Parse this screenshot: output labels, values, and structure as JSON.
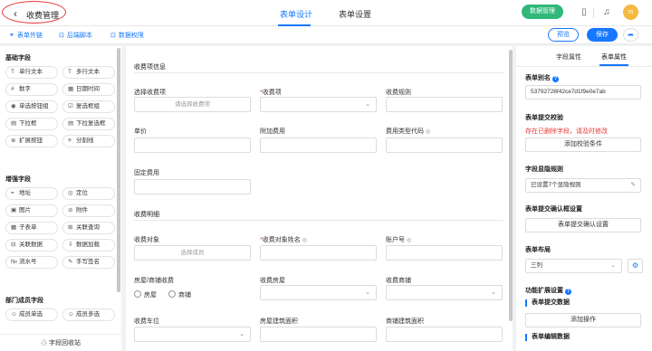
{
  "header": {
    "back_icon": "chevron-left-icon",
    "title": "收费管理",
    "tabs": [
      {
        "label": "表单设计",
        "active": true
      },
      {
        "label": "表单设置",
        "active": false
      }
    ],
    "data_button": "数据管理",
    "avatar_text": "rs",
    "colors": {
      "accent": "#1677ff",
      "data_button": "#2fb87a",
      "avatar": "#f5b93f",
      "highlight": "#e53935"
    }
  },
  "toolbar": {
    "links": [
      "表单外链",
      "后端脚本",
      "数据权限"
    ],
    "preview": "预览",
    "save": "保存"
  },
  "left": {
    "sections": [
      {
        "title": "基础字段",
        "fields": [
          {
            "icon": "text-icon",
            "glyph": "T",
            "label": "单行文本"
          },
          {
            "icon": "textarea-icon",
            "glyph": "T",
            "label": "多行文本"
          },
          {
            "icon": "number-icon",
            "glyph": "#",
            "label": "数字"
          },
          {
            "icon": "calendar-icon",
            "glyph": "▦",
            "label": "日期时间"
          },
          {
            "icon": "radio-icon",
            "glyph": "◉",
            "label": "单选按钮组"
          },
          {
            "icon": "checkbox-icon",
            "glyph": "☑",
            "label": "复选框组"
          },
          {
            "icon": "dropdown-icon",
            "glyph": "▤",
            "label": "下拉框"
          },
          {
            "icon": "multi-dropdown-icon",
            "glyph": "▤",
            "label": "下拉复选框"
          },
          {
            "icon": "expand-button-icon",
            "glyph": "⊕",
            "label": "扩展按钮"
          },
          {
            "icon": "divider-icon",
            "glyph": "≡",
            "label": "分割线"
          }
        ]
      },
      {
        "title": "增强字段",
        "fields": [
          {
            "icon": "address-icon",
            "glyph": "⌖",
            "label": "地址"
          },
          {
            "icon": "location-icon",
            "glyph": "◎",
            "label": "定位"
          },
          {
            "icon": "image-icon",
            "glyph": "▣",
            "label": "图片"
          },
          {
            "icon": "attachment-icon",
            "glyph": "⊘",
            "label": "附件"
          },
          {
            "icon": "subform-icon",
            "glyph": "▦",
            "label": "子表单"
          },
          {
            "icon": "related-query-icon",
            "glyph": "⊞",
            "label": "关联查询"
          },
          {
            "icon": "related-data-icon",
            "glyph": "⊟",
            "label": "关联数据"
          },
          {
            "icon": "data-load-icon",
            "glyph": "⇩",
            "label": "数据加载"
          },
          {
            "icon": "serial-number-icon",
            "glyph": "№",
            "label": "流水号"
          },
          {
            "icon": "signature-icon",
            "glyph": "✎",
            "label": "手写签名"
          }
        ]
      },
      {
        "title": "部门成员字段",
        "fields": [
          {
            "icon": "member-icon",
            "glyph": "☺",
            "label": "成员单选"
          },
          {
            "icon": "members-icon",
            "glyph": "☺",
            "label": "成员多选"
          }
        ]
      }
    ],
    "recycle": "字段回收站"
  },
  "form": {
    "groups": [
      {
        "title": "收费项信息"
      },
      {
        "title": "收费明细"
      }
    ],
    "fields": [
      {
        "label": "选择收费项",
        "required": false,
        "hidden_icon": false,
        "placeholder": "请选择收费项",
        "chevron": false
      },
      {
        "label": "收费项",
        "required": true,
        "hidden_icon": false,
        "placeholder": "",
        "chevron": true
      },
      {
        "label": "收费规则",
        "required": false,
        "hidden_icon": false,
        "placeholder": "",
        "chevron": false
      },
      {
        "label": "单价",
        "required": false,
        "hidden_icon": false,
        "placeholder": "",
        "chevron": false
      },
      {
        "label": "附加费用",
        "required": false,
        "hidden_icon": false,
        "placeholder": "",
        "chevron": false
      },
      {
        "label": "费用类型代码",
        "required": false,
        "hidden_icon": true,
        "placeholder": "",
        "chevron": false
      },
      {
        "label": "固定费用",
        "required": false,
        "hidden_icon": false,
        "placeholder": "",
        "chevron": false
      },
      {
        "label": "收费对象",
        "required": false,
        "hidden_icon": false,
        "placeholder": "选择成员",
        "chevron": false
      },
      {
        "label": "收费对象姓名",
        "required": true,
        "hidden_icon": true,
        "placeholder": "",
        "chevron": false
      },
      {
        "label": "账户号",
        "required": false,
        "hidden_icon": true,
        "placeholder": "",
        "chevron": false
      },
      {
        "label": "房屋/商铺收费",
        "required": false,
        "hidden_icon": false,
        "placeholder": "",
        "chevron": false
      },
      {
        "label": "收费房屋",
        "required": false,
        "hidden_icon": false,
        "placeholder": "",
        "chevron": true
      },
      {
        "label": "收费商铺",
        "required": false,
        "hidden_icon": false,
        "placeholder": "",
        "chevron": true
      },
      {
        "label": "收费车位",
        "required": false,
        "hidden_icon": false,
        "placeholder": "",
        "chevron": true
      },
      {
        "label": "房屋建筑面积",
        "required": false,
        "hidden_icon": false,
        "placeholder": "",
        "chevron": false
      },
      {
        "label": "商铺建筑面积",
        "required": false,
        "hidden_icon": false,
        "placeholder": "",
        "chevron": false
      }
    ],
    "radio_options": [
      "房屋",
      "商铺"
    ],
    "required_mark": "*",
    "chevron_glyph": "⌄",
    "eye_glyph": "◎"
  },
  "right": {
    "tabs": [
      "字段属性",
      "表单属性"
    ],
    "form_alias_label": "表单别名",
    "form_alias_value": "53792728f42ce7d1f9e0e7ab",
    "submit_validate_label": "表单提交校验",
    "submit_validate_error": "存在已删除字段，请及时修改",
    "add_validate_button": "添加校验条件",
    "visibility_label": "字段显隐规则",
    "visibility_value": "已设置7个显隐规则",
    "confirm_label": "表单提交确认框设置",
    "confirm_button": "表单提交确认设置",
    "layout_label": "表单布局",
    "layout_value": "三列",
    "ext_label": "功能扩展设置",
    "submit_data_label": "表单提交数据",
    "add_action_button": "添加操作",
    "edit_data_label": "表单编辑数据"
  }
}
